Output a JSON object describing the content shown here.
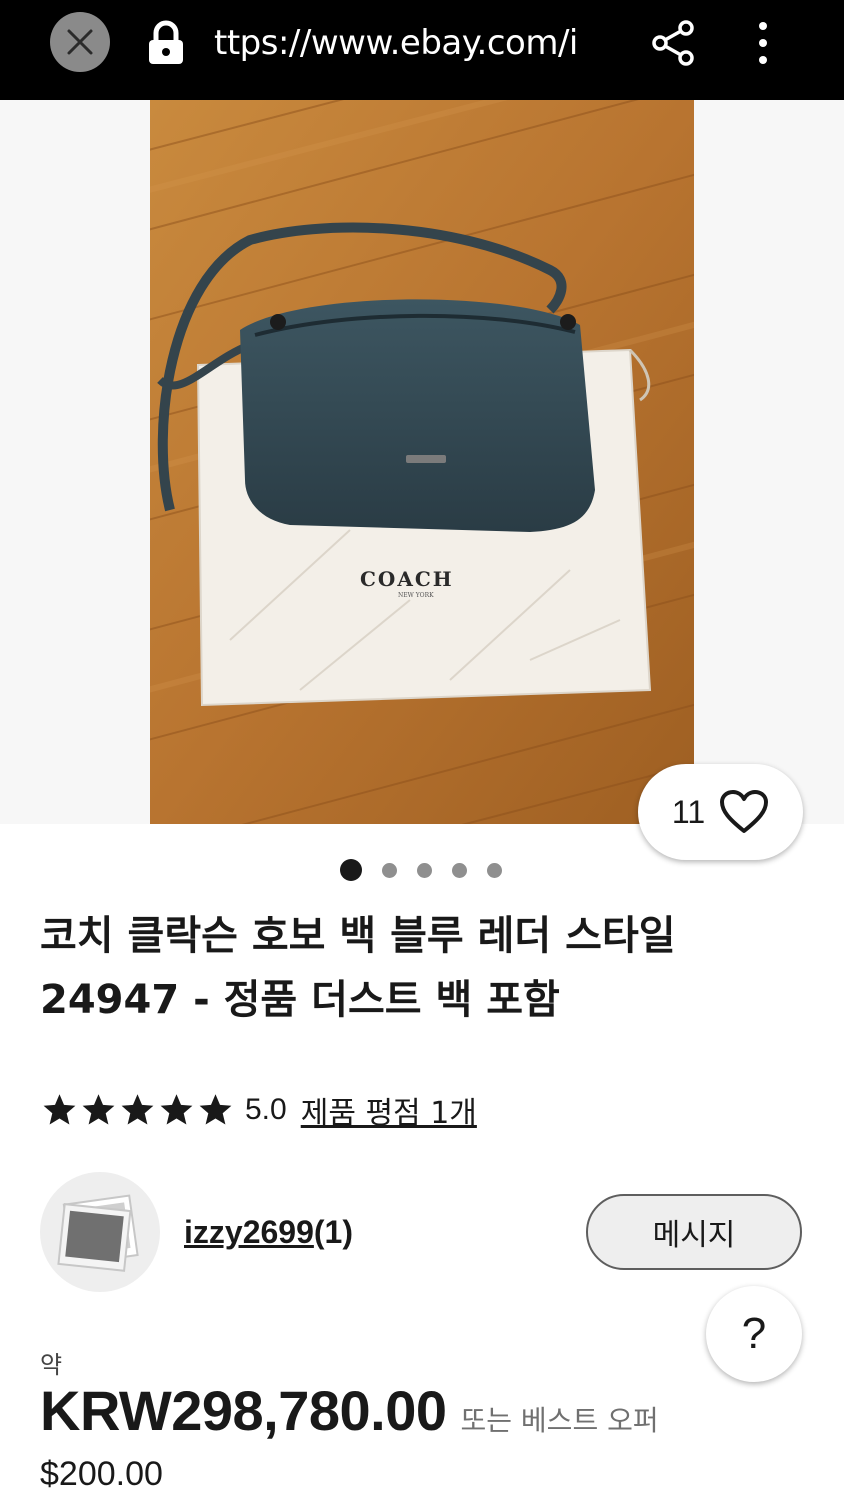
{
  "browser": {
    "url": "ttps://www.ebay.com/i"
  },
  "gallery": {
    "photo_text": {
      "brand": "COACH",
      "sub": "NEW YORK"
    },
    "photo_count": 5,
    "active_index": 0,
    "watch_count": "11"
  },
  "listing": {
    "title": "코치 클락슨 호보 백 블루 레더 스타일 24947 - 정품 더스트 백 포함",
    "rating": {
      "stars": 5,
      "value": "5.0",
      "link": "제품 평점 1개"
    },
    "seller": {
      "name": "izzy2699",
      "feedback": "(1)",
      "message_label": "메시지"
    },
    "help_label": "?",
    "price": {
      "approx_label": "약",
      "converted": "KRW298,780.00",
      "best_offer": "또는 베스트 오퍼",
      "original": "$200.00"
    }
  },
  "colors": {
    "topbar": "#000000",
    "text": "#191919",
    "muted": "#707070"
  }
}
